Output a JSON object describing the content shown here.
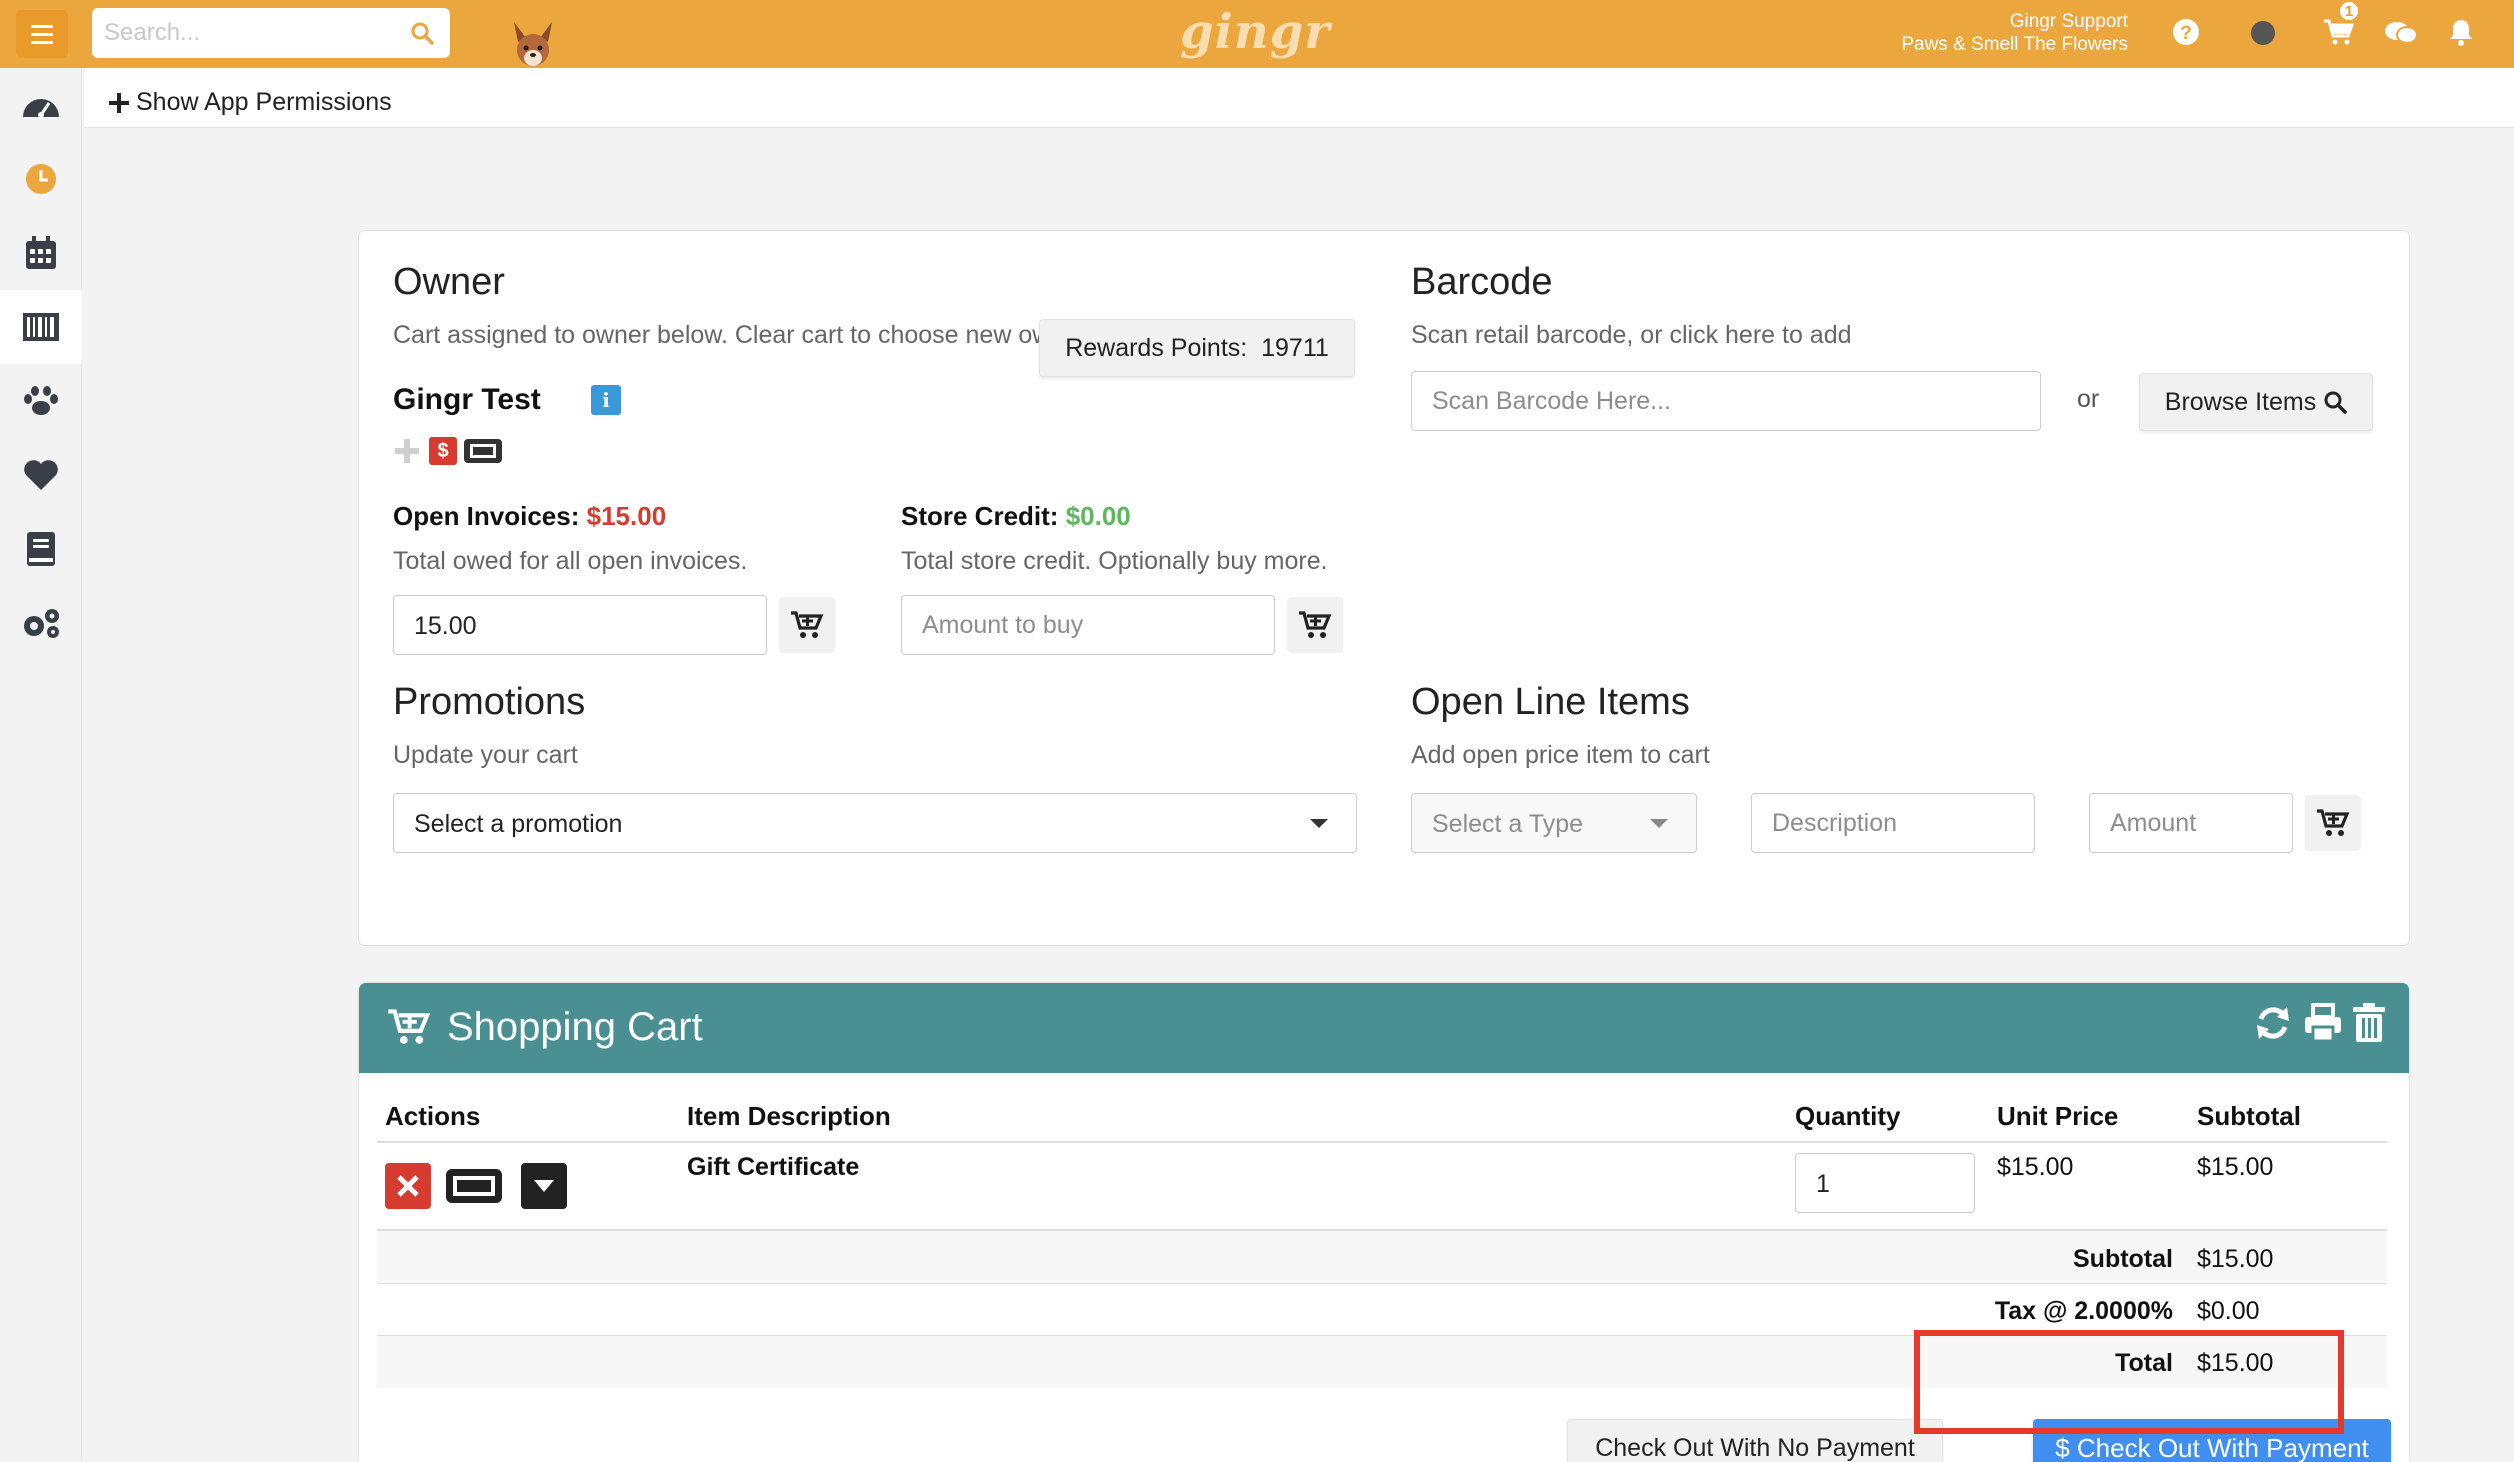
{
  "header": {
    "search_placeholder": "Search...",
    "logo": "gingr",
    "user_name": "Gingr Support",
    "business_name": "Paws & Smell The Flowers",
    "cart_count": "1",
    "icons": [
      "menu-icon",
      "search-icon",
      "dog-icon",
      "help-icon",
      "status-dot-icon",
      "cart-icon",
      "chat-icon",
      "bell-icon"
    ]
  },
  "sidebar": {
    "items": [
      {
        "name": "dashboard",
        "icon": "speedometer-icon"
      },
      {
        "name": "clock",
        "icon": "clock-icon"
      },
      {
        "name": "calendar",
        "icon": "calendar-icon"
      },
      {
        "name": "pos",
        "icon": "barcode-icon"
      },
      {
        "name": "pets",
        "icon": "paw-icon"
      },
      {
        "name": "favorites",
        "icon": "heart-icon"
      },
      {
        "name": "reports",
        "icon": "book-icon"
      },
      {
        "name": "settings",
        "icon": "gears-icon"
      }
    ]
  },
  "permissions": {
    "label": "Show App Permissions"
  },
  "owner": {
    "heading": "Owner",
    "subtext": "Cart assigned to owner below. Clear cart to choose new owner.",
    "name": "Gingr Test",
    "info_icon": "i",
    "rewards_label": "Rewards Points:",
    "rewards_value": "19711",
    "money_badge": "$"
  },
  "invoices": {
    "label": "Open Invoices:",
    "amount": "$15.00",
    "subtext": "Total owed for all open invoices.",
    "input_value": "15.00"
  },
  "store_credit": {
    "label": "Store Credit:",
    "amount": "$0.00",
    "subtext": "Total store credit. Optionally buy more.",
    "placeholder": "Amount to buy"
  },
  "barcode": {
    "heading": "Barcode",
    "subtext": "Scan retail barcode, or click here to add",
    "placeholder": "Scan Barcode Here...",
    "or_text": "or",
    "browse_label": "Browse Items"
  },
  "promotions": {
    "heading": "Promotions",
    "subtext": "Update your cart",
    "select_value": "Select a promotion"
  },
  "open_line_items": {
    "heading": "Open Line Items",
    "subtext": "Add open price item to cart",
    "type_value": "Select a Type",
    "description_placeholder": "Description",
    "amount_placeholder": "Amount"
  },
  "cart": {
    "title": "Shopping Cart",
    "columns": [
      "Actions",
      "Item Description",
      "Quantity",
      "Unit Price",
      "Subtotal"
    ],
    "rows": [
      {
        "description": "Gift Certificate",
        "quantity": "1",
        "unit_price": "$15.00",
        "subtotal": "$15.00"
      }
    ],
    "totals": {
      "subtotal_label": "Subtotal",
      "subtotal_value": "$15.00",
      "tax_label": "Tax @ 2.0000%",
      "tax_value": "$0.00",
      "total_label": "Total",
      "total_value": "$15.00"
    },
    "no_payment_label": "Check Out With No Payment",
    "payment_label": "$ Check Out With Payment"
  },
  "colors": {
    "header": "#eca63e",
    "cart_header": "#4a8f92",
    "primary": "#3f8ef0",
    "danger": "#d63b2f",
    "success": "#5cb85c",
    "highlight": "#e53a2b"
  }
}
